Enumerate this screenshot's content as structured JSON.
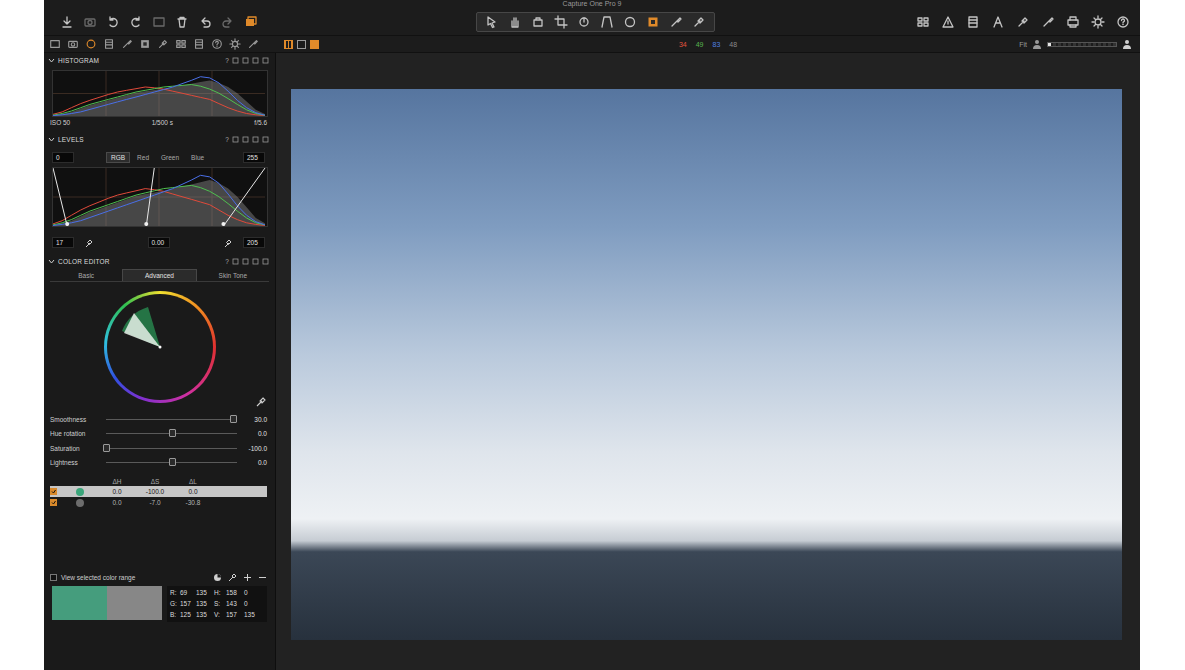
{
  "window": {
    "title": "Capture One Pro 9"
  },
  "tool_tabs": [
    {
      "selected": false
    },
    {
      "selected": false
    },
    {
      "selected": true
    },
    {
      "selected": false
    },
    {
      "selected": false
    },
    {
      "selected": false
    },
    {
      "selected": false
    },
    {
      "selected": false
    },
    {
      "selected": false
    },
    {
      "selected": false
    },
    {
      "selected": false
    },
    {
      "selected": false
    }
  ],
  "viewer_modes": [
    {
      "selected": true
    },
    {
      "selected": false
    },
    {
      "selected": false
    }
  ],
  "counts": [
    {
      "value": "34",
      "color": "#e2533e"
    },
    {
      "value": "49",
      "color": "#58b44f"
    },
    {
      "value": "83",
      "color": "#4f7fe0"
    },
    {
      "value": "48",
      "color": "#8a8a8a"
    }
  ],
  "zoom": {
    "label": "Fit",
    "level": 0.05
  },
  "histogram": {
    "title": "HISTOGRAM",
    "help": "?",
    "iso": "ISO 50",
    "shutter": "1/500 s",
    "aperture": "f/5.6",
    "series": [
      {
        "color": "#8c8c8c",
        "values": [
          2,
          5,
          10,
          18,
          26,
          32,
          38,
          44,
          50,
          56,
          60,
          63,
          66,
          70,
          74,
          78,
          82,
          86,
          80,
          70,
          55,
          35,
          15,
          5
        ]
      },
      {
        "color": "#e04a3a",
        "values": [
          4,
          10,
          20,
          30,
          38,
          45,
          52,
          58,
          62,
          66,
          70,
          68,
          65,
          60,
          55,
          50,
          45,
          40,
          30,
          20,
          12,
          6,
          3,
          1
        ]
      },
      {
        "color": "#4fc04f",
        "values": [
          2,
          6,
          12,
          20,
          28,
          34,
          40,
          46,
          52,
          58,
          62,
          66,
          70,
          72,
          74,
          76,
          72,
          65,
          55,
          42,
          28,
          15,
          6,
          2
        ]
      },
      {
        "color": "#4a6fe8",
        "values": [
          1,
          3,
          6,
          10,
          16,
          22,
          28,
          34,
          40,
          46,
          52,
          58,
          64,
          70,
          78,
          86,
          95,
          92,
          80,
          60,
          38,
          20,
          8,
          2
        ]
      }
    ]
  },
  "levels": {
    "title": "LEVELS",
    "help": "?",
    "output_low": "0",
    "output_high": "255",
    "channels": [
      {
        "label": "RGB",
        "selected": true
      },
      {
        "label": "Red",
        "selected": false
      },
      {
        "label": "Green",
        "selected": false
      },
      {
        "label": "Blue",
        "selected": false
      }
    ],
    "low": "17",
    "mid": "0.00",
    "high": "205",
    "low_level": 0.067,
    "mid_level": 0.44,
    "high_level": 0.804,
    "series": [
      {
        "color": "#8c8c8c",
        "values": [
          2,
          5,
          10,
          18,
          26,
          32,
          38,
          44,
          50,
          56,
          60,
          63,
          66,
          70,
          74,
          78,
          82,
          86,
          80,
          70,
          55,
          35,
          15,
          5
        ]
      },
      {
        "color": "#e04a3a",
        "values": [
          4,
          10,
          20,
          30,
          38,
          45,
          52,
          58,
          62,
          66,
          70,
          68,
          65,
          60,
          55,
          50,
          45,
          40,
          30,
          20,
          12,
          6,
          3,
          1
        ]
      },
      {
        "color": "#4fc04f",
        "values": [
          2,
          6,
          12,
          20,
          28,
          34,
          40,
          46,
          52,
          58,
          62,
          66,
          70,
          72,
          74,
          76,
          72,
          65,
          55,
          42,
          28,
          15,
          6,
          2
        ]
      },
      {
        "color": "#4a6fe8",
        "values": [
          1,
          3,
          6,
          10,
          16,
          22,
          28,
          34,
          40,
          46,
          52,
          58,
          64,
          70,
          78,
          86,
          95,
          92,
          80,
          60,
          38,
          20,
          8,
          2
        ]
      }
    ]
  },
  "color_editor": {
    "title": "COLOR EDITOR",
    "help": "?",
    "tabs": [
      {
        "label": "Basic",
        "selected": false
      },
      {
        "label": "Advanced",
        "selected": true
      },
      {
        "label": "Skin Tone",
        "selected": false
      }
    ],
    "sliders": [
      {
        "label": "Smoothness",
        "value": "30.0",
        "level": 0.97
      },
      {
        "label": "Hue rotation",
        "value": "0.0",
        "level": 0.5
      },
      {
        "label": "Saturation",
        "value": "-100.0",
        "level": 0.0
      },
      {
        "label": "Lightness",
        "value": "0.0",
        "level": 0.5
      }
    ],
    "table": {
      "columns": [
        "ΔH",
        "ΔS",
        "ΔL"
      ],
      "rows": [
        {
          "checked": true,
          "selected": true,
          "color": "#3aa57a",
          "values": [
            "0.0",
            "-100.0",
            "0.0"
          ]
        },
        {
          "checked": true,
          "selected": false,
          "color": "#6d6d6d",
          "values": [
            "0.0",
            "-7.0",
            "-30.8"
          ]
        }
      ]
    },
    "view_range": {
      "label": "View selected color range",
      "checked": false
    },
    "swatches": [
      {
        "color": "#459d7d"
      },
      {
        "color": "#878787"
      }
    ],
    "readout": [
      [
        "R:",
        "69",
        "135",
        "H:",
        "158",
        "0"
      ],
      [
        "G:",
        "157",
        "135",
        "S:",
        "143",
        "0"
      ],
      [
        "B:",
        "125",
        "135",
        "V:",
        "157",
        "135"
      ]
    ]
  }
}
